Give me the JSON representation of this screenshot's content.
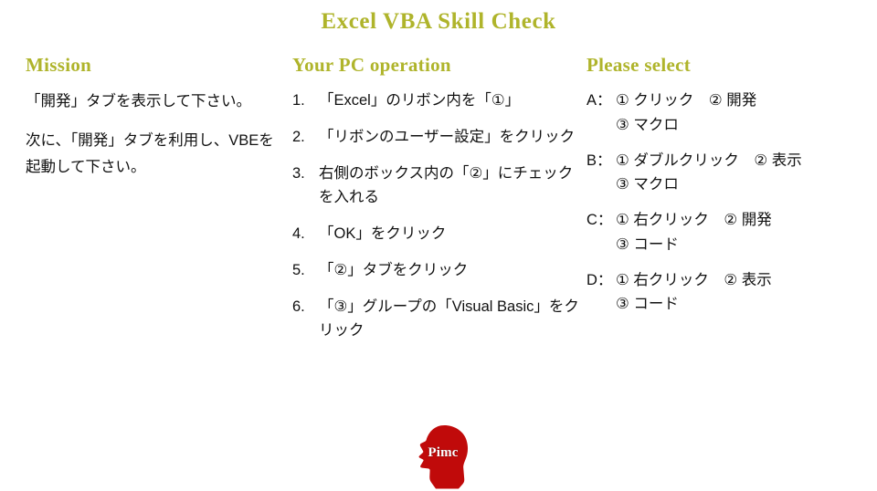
{
  "title": "Excel VBA Skill Check",
  "colors": {
    "heading": "#AFB42B",
    "text": "#111111",
    "logo": "#C00A0A",
    "background": "#FFFFFF"
  },
  "mission": {
    "heading": "Mission",
    "paragraphs": [
      "「開発」タブを表示して下さい。",
      "次に、「開発」タブを利用し、VBEを起動して下さい。"
    ]
  },
  "operation": {
    "heading": "Your PC operation",
    "steps": [
      {
        "number": "1.",
        "text": "「Excel」のリボン内を「①」"
      },
      {
        "number": "2.",
        "text": "「リボンのユーザー設定」をクリック"
      },
      {
        "number": "3.",
        "text": "右側のボックス内の「②」にチェックを入れる"
      },
      {
        "number": "4.",
        "text": "「OK」をクリック"
      },
      {
        "number": "5.",
        "text": "「②」タブをクリック"
      },
      {
        "number": "6.",
        "text": "「③」グループの「Visual Basic」をクリック"
      }
    ]
  },
  "select": {
    "heading": "Please select",
    "choices": [
      {
        "key": "A：",
        "line1": "① クリック　② 開発",
        "line2": "③ マクロ"
      },
      {
        "key": "B：",
        "line1": "① ダブルクリック　② 表示",
        "line2": "③ マクロ"
      },
      {
        "key": "C：",
        "line1": "① 右クリック　② 開発",
        "line2": "③ コード"
      },
      {
        "key": "D：",
        "line1": "① 右クリック　② 表示",
        "line2": "③ コード"
      }
    ]
  },
  "logo": {
    "label": "Pimc",
    "icon": "head-silhouette-icon"
  }
}
